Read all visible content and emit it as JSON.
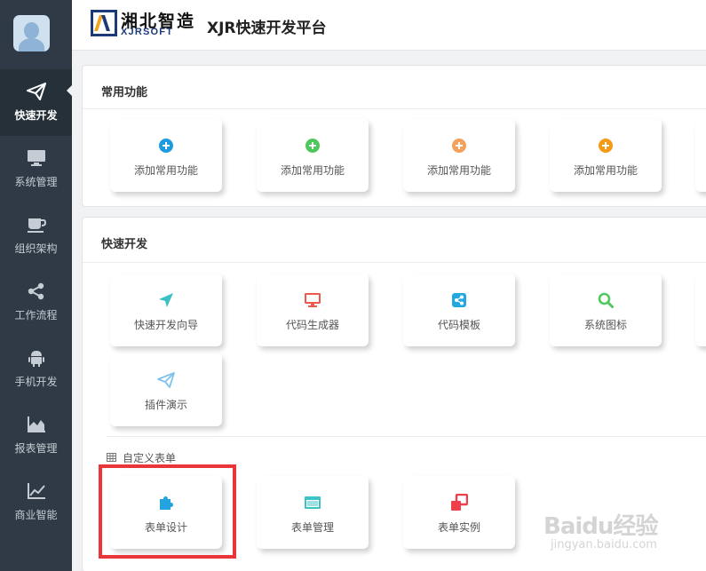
{
  "header": {
    "brand_cn": "湘北智造",
    "brand_en": "XJRSOFT",
    "app_title": "XJR快速开发平台"
  },
  "sidebar": {
    "items": [
      {
        "label": "快速开发",
        "icon": "paper-plane-icon",
        "active": true
      },
      {
        "label": "系统管理",
        "icon": "monitor-icon"
      },
      {
        "label": "组织架构",
        "icon": "coffee-cup-icon"
      },
      {
        "label": "工作流程",
        "icon": "share-nodes-icon"
      },
      {
        "label": "手机开发",
        "icon": "android-icon"
      },
      {
        "label": "报表管理",
        "icon": "area-chart-icon"
      },
      {
        "label": "商业智能",
        "icon": "line-chart-icon"
      }
    ]
  },
  "common": {
    "title": "常用功能",
    "cards": [
      {
        "label": "添加常用功能",
        "icon": "plus-circle-icon",
        "color": "#1e9be0"
      },
      {
        "label": "添加常用功能",
        "icon": "plus-circle-icon",
        "color": "#4cc95a"
      },
      {
        "label": "添加常用功能",
        "icon": "plus-circle-icon",
        "color": "#f6a15b"
      },
      {
        "label": "添加常用功能",
        "icon": "plus-circle-icon",
        "color": "#f39b17"
      }
    ]
  },
  "quick": {
    "title": "快速开发",
    "cards": [
      {
        "label": "快速开发向导",
        "icon": "location-arrow-icon",
        "color": "#3cc0c8"
      },
      {
        "label": "代码生成器",
        "icon": "desktop-icon",
        "color": "#ee5b4e"
      },
      {
        "label": "代码模板",
        "icon": "share-square-icon",
        "color": "#23a9e2"
      },
      {
        "label": "系统图标",
        "icon": "search-icon",
        "color": "#52c75f"
      },
      {
        "label": "插件演示",
        "icon": "paper-plane-icon",
        "color": "#7fc2ea"
      }
    ],
    "subsection": "自定义表单",
    "form_cards": [
      {
        "label": "表单设计",
        "icon": "puzzle-icon",
        "color": "#23a3e0"
      },
      {
        "label": "表单管理",
        "icon": "list-window-icon",
        "color": "#3dc2c9"
      },
      {
        "label": "表单实例",
        "icon": "clone-icon",
        "color": "#ee3f4a"
      }
    ]
  },
  "watermark": {
    "main": "Baidu经验",
    "sub": "jingyan.baidu.com"
  },
  "colors": {
    "sidebar_bg": "#2f3a46",
    "sidebar_active": "#263039",
    "highlight": "#e8363a",
    "brand_blue": "#1d3a78",
    "brand_orange": "#f2a51f"
  }
}
